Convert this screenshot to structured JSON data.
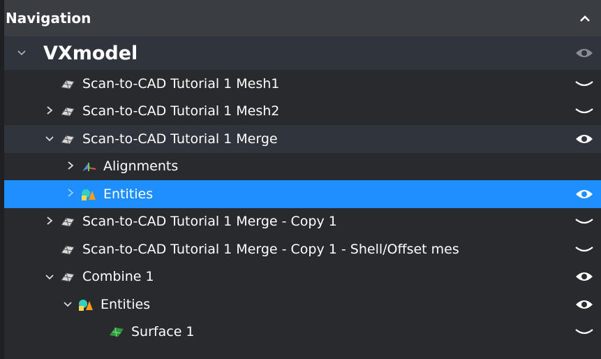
{
  "panel": {
    "title": "Navigation"
  },
  "tree": {
    "root": {
      "label": "VXmodel"
    },
    "items": [
      {
        "label": "Scan-to-CAD Tutorial 1 Mesh1"
      },
      {
        "label": "Scan-to-CAD Tutorial 1 Mesh2"
      },
      {
        "label": "Scan-to-CAD Tutorial 1 Merge"
      },
      {
        "label": "Alignments"
      },
      {
        "label": "Entities"
      },
      {
        "label": "Scan-to-CAD Tutorial 1 Merge - Copy 1"
      },
      {
        "label": "Scan-to-CAD Tutorial 1 Merge - Copy 1 - Shell/Offset mes"
      },
      {
        "label": "Combine 1"
      },
      {
        "label": "Entities"
      },
      {
        "label": "Surface 1"
      }
    ]
  }
}
